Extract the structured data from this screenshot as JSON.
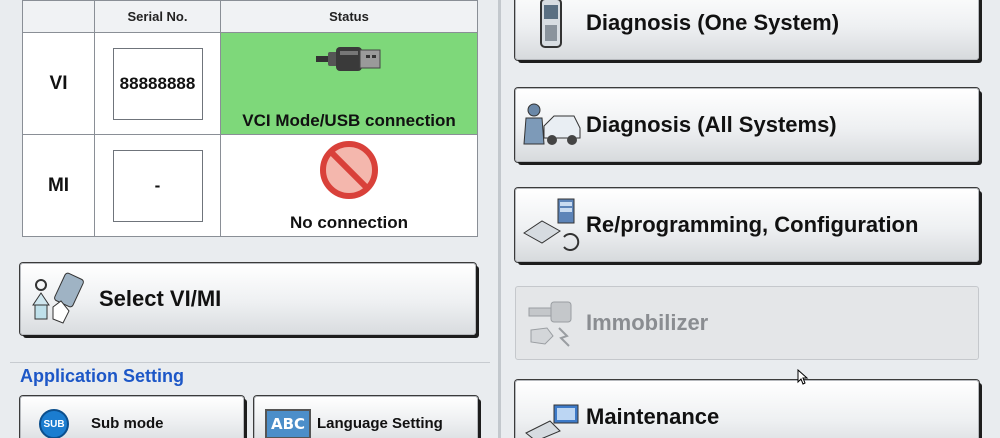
{
  "vi_table": {
    "headers": [
      "",
      "Serial No.",
      "Status"
    ],
    "rows": [
      {
        "label": "VI",
        "serial": "88888888",
        "status": "VCI Mode/USB connection",
        "status_icon": "usb-icon",
        "status_color": "#7ed87a"
      },
      {
        "label": "MI",
        "serial": "-",
        "status": "No connection",
        "status_icon": "no-entry-icon",
        "status_color": "#ffffff"
      }
    ]
  },
  "select_button": {
    "label": "Select VI/MI",
    "icon": "select-device-icon"
  },
  "application_setting": {
    "title": "Application Setting",
    "buttons": [
      {
        "label": "Sub mode",
        "badge": "SUB",
        "icon": "sub-mode-icon"
      },
      {
        "label": "Language Setting",
        "badge": "ABC",
        "icon": "language-icon"
      }
    ]
  },
  "menu": [
    {
      "label": "Diagnosis (One System)",
      "icon": "handheld-device-icon",
      "enabled": true
    },
    {
      "label": "Diagnosis (All Systems)",
      "icon": "mechanic-car-icon",
      "enabled": true
    },
    {
      "label": "Re/programming, Configuration",
      "icon": "reprogram-icon",
      "enabled": true
    },
    {
      "label": "Immobilizer",
      "icon": "key-icon",
      "enabled": false
    },
    {
      "label": "Maintenance",
      "icon": "maintenance-icon",
      "enabled": true
    }
  ],
  "colors": {
    "accent_blue": "#1d57c7",
    "connected_green": "#7ed87a"
  }
}
